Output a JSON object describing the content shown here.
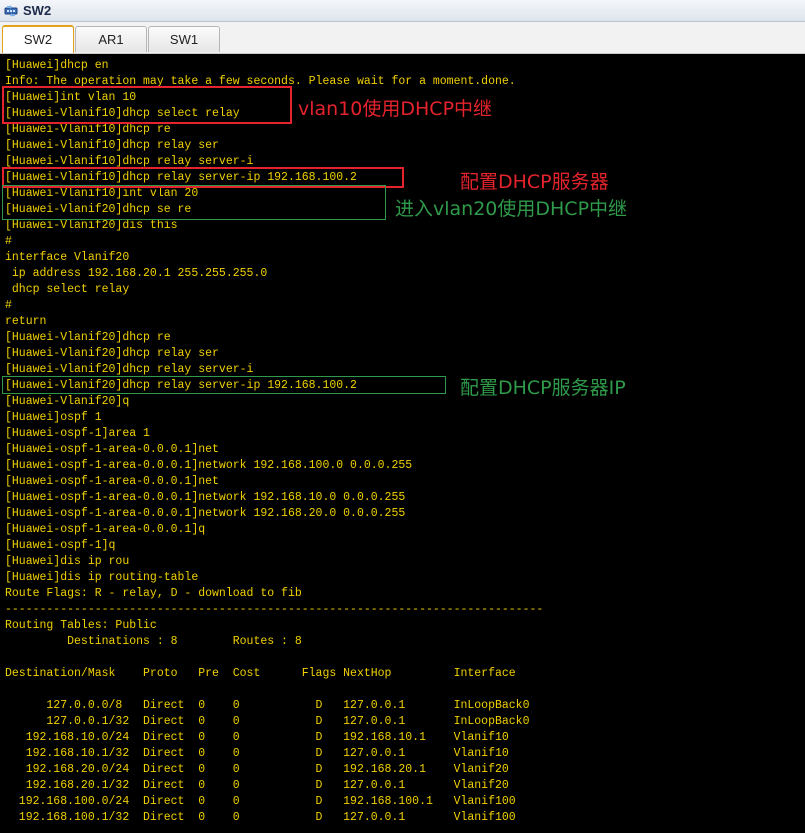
{
  "window": {
    "title": "SW2",
    "icon": "switch-icon"
  },
  "tabs": [
    {
      "label": "SW2",
      "active": true
    },
    {
      "label": "AR1",
      "active": false
    },
    {
      "label": "SW1",
      "active": false
    }
  ],
  "colors": {
    "terminal_text": "#f0d000",
    "terminal_bg": "#000000",
    "annotation_red": "#e4232c",
    "annotation_green": "#2f9a4a"
  },
  "terminal": {
    "lines": [
      "[Huawei]dhcp en",
      "Info: The operation may take a few seconds. Please wait for a moment.done.",
      "[Huawei]int vlan 10",
      "[Huawei-Vlanif10]dhcp select relay",
      "[Huawei-Vlanif10]dhcp re",
      "[Huawei-Vlanif10]dhcp relay ser",
      "[Huawei-Vlanif10]dhcp relay server-i",
      "[Huawei-Vlanif10]dhcp relay server-ip 192.168.100.2",
      "[Huawei-Vlanif10]int vlan 20",
      "[Huawei-Vlanif20]dhcp se re",
      "[Huawei-Vlanif20]dis this",
      "#",
      "interface Vlanif20",
      " ip address 192.168.20.1 255.255.255.0",
      " dhcp select relay",
      "#",
      "return",
      "[Huawei-Vlanif20]dhcp re",
      "[Huawei-Vlanif20]dhcp relay ser",
      "[Huawei-Vlanif20]dhcp relay server-i",
      "[Huawei-Vlanif20]dhcp relay server-ip 192.168.100.2",
      "[Huawei-Vlanif20]q",
      "[Huawei]ospf 1",
      "[Huawei-ospf-1]area 1",
      "[Huawei-ospf-1-area-0.0.0.1]net",
      "[Huawei-ospf-1-area-0.0.0.1]network 192.168.100.0 0.0.0.255",
      "[Huawei-ospf-1-area-0.0.0.1]net",
      "[Huawei-ospf-1-area-0.0.0.1]network 192.168.10.0 0.0.0.255",
      "[Huawei-ospf-1-area-0.0.0.1]network 192.168.20.0 0.0.0.255",
      "[Huawei-ospf-1-area-0.0.0.1]q",
      "[Huawei-ospf-1]q",
      "[Huawei]dis ip rou",
      "[Huawei]dis ip routing-table",
      "Route Flags: R - relay, D - download to fib",
      "------------------------------------------------------------------------------",
      "Routing Tables: Public",
      "         Destinations : 8        Routes : 8",
      "",
      "Destination/Mask    Proto   Pre  Cost      Flags NextHop         Interface",
      "",
      "      127.0.0.0/8   Direct  0    0           D   127.0.0.1       InLoopBack0",
      "      127.0.0.1/32  Direct  0    0           D   127.0.0.1       InLoopBack0",
      "   192.168.10.0/24  Direct  0    0           D   192.168.10.1    Vlanif10",
      "   192.168.10.1/32  Direct  0    0           D   127.0.0.1       Vlanif10",
      "   192.168.20.0/24  Direct  0    0           D   192.168.20.1    Vlanif20",
      "   192.168.20.1/32  Direct  0    0           D   127.0.0.1       Vlanif20",
      "  192.168.100.0/24  Direct  0    0           D   192.168.100.1   Vlanif100",
      "  192.168.100.1/32  Direct  0    0           D   127.0.0.1       Vlanif100"
    ]
  },
  "annotations": [
    {
      "text": "vlan10使用DHCP中继",
      "color": "red"
    },
    {
      "text": "配置DHCP服务器",
      "color": "red"
    },
    {
      "text": "进入vlan20使用DHCP中继",
      "color": "green"
    },
    {
      "text": "配置DHCP服务器IP",
      "color": "green"
    }
  ]
}
